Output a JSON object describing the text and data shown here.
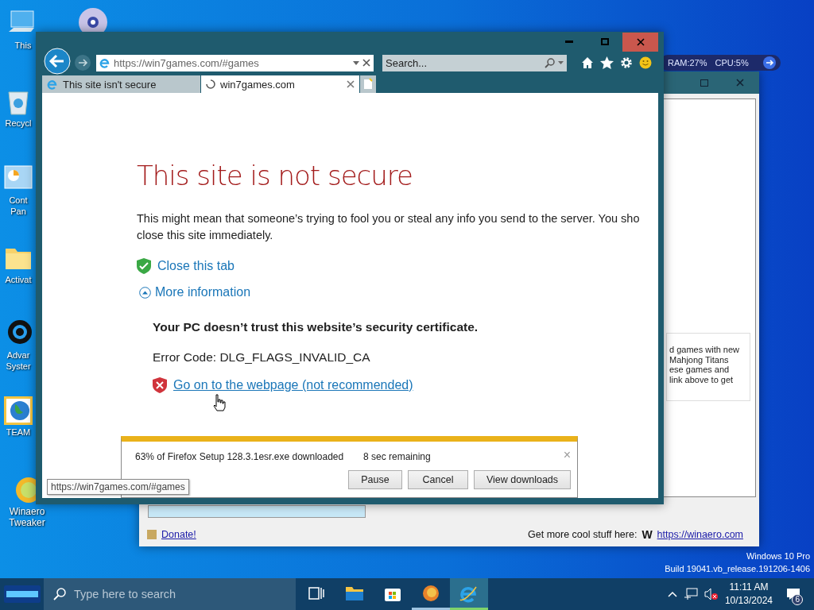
{
  "desktop_icons": [
    {
      "kind": "computer",
      "lines": [
        "This"
      ]
    },
    {
      "kind": "disc"
    },
    {
      "kind": "recycle",
      "lines": [
        "Recycl"
      ]
    },
    {
      "kind": "control",
      "lines": [
        "Cont",
        "Pan"
      ]
    },
    {
      "kind": "folder",
      "lines": [
        "Activat"
      ]
    },
    {
      "kind": "ring",
      "lines": [
        "Advar",
        "Syster"
      ]
    },
    {
      "kind": "globe",
      "lines": [
        "TEAM"
      ]
    },
    {
      "kind": "tweaker",
      "lines": [
        "Winaero",
        "Tweaker"
      ]
    }
  ],
  "gadget": {
    "ram": "RAM:27%",
    "cpu": "CPU:5%"
  },
  "background_window": {
    "text_lines": [
      "d games with new",
      "Mahjong Titans",
      "ese games and",
      "link above to get"
    ],
    "status_bar": {
      "link": "Donate!",
      "label": "Get more cool stuff here:",
      "logo": "W",
      "url": "https://winaero.com"
    }
  },
  "browser": {
    "address": "https://win7games.com/#games",
    "search": {
      "placeholder": "Search..."
    },
    "tabs": [
      {
        "label": "This site isn't secure",
        "selected": false,
        "loading": false
      },
      {
        "label": "win7games.com",
        "selected": true,
        "loading": true
      }
    ],
    "page": {
      "heading": "This site is not secure",
      "paragraph_lines": [
        "This might mean that someone’s trying to fool you or steal any info you send to the server. You sho",
        "close this site immediately."
      ],
      "close_link": "Close this tab",
      "more_info": {
        "label": "More information",
        "expanded": true
      },
      "detail": "Your PC doesn’t trust this website’s security certificate.",
      "error_code": "Error Code: DLG_FLAGS_INVALID_CA",
      "unsafe_link": "Go on to the webpage (not recommended)"
    },
    "status_tooltip": "https://win7games.com/#games",
    "download": {
      "message": "63% of Firefox Setup 128.3.1esr.exe downloaded",
      "remaining": "8 sec remaining",
      "buttons": [
        "Pause",
        "Cancel",
        "View downloads"
      ],
      "close": "×"
    }
  },
  "watermark": [
    "Windows 10 Pro",
    "Build 19041.vb_release.191206-1406"
  ],
  "taskbar": {
    "search": {
      "placeholder": "Type here to search"
    },
    "apps": [
      {
        "kind": "taskview",
        "selected": false,
        "running": false
      },
      {
        "kind": "explorer",
        "selected": false,
        "running": false
      },
      {
        "kind": "store",
        "selected": false,
        "running": false
      },
      {
        "kind": "firefox",
        "selected": false,
        "running": true
      },
      {
        "kind": "ie",
        "selected": true,
        "running": true
      }
    ],
    "tray": {
      "muted": true,
      "time": "11:11 AM",
      "date": "10/13/2024",
      "notifications": "6"
    }
  }
}
